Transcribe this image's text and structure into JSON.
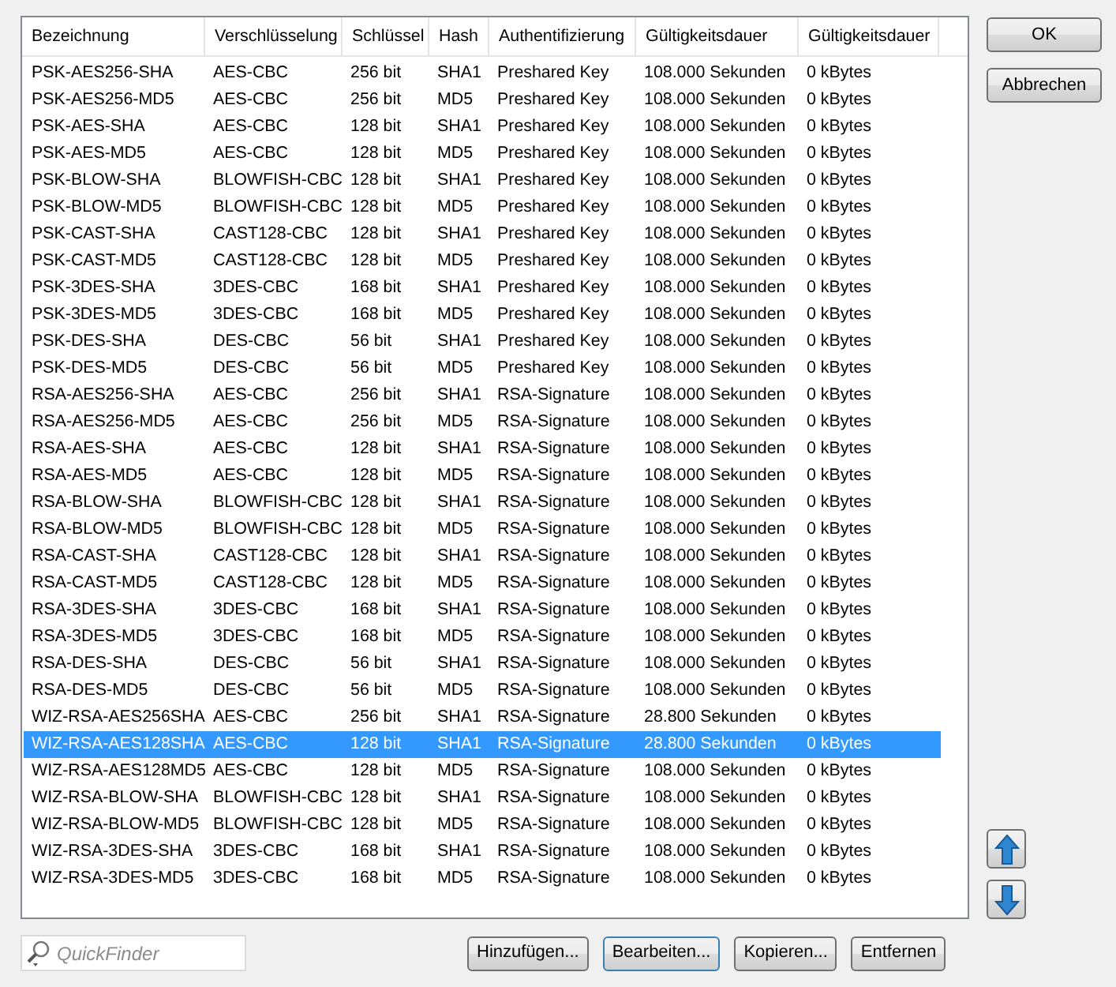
{
  "table": {
    "columns": [
      "Bezeichnung",
      "Verschlüsselung",
      "Schlüssel",
      "Hash",
      "Authentifizierung",
      "Gültigkeitsdauer",
      "Gültigkeitsdauer"
    ],
    "rows": [
      {
        "cells": [
          "PSK-AES256-SHA",
          "AES-CBC",
          "256 bit",
          "SHA1",
          "Preshared Key",
          "108.000 Sekunden",
          "0 kBytes"
        ],
        "selected": false
      },
      {
        "cells": [
          "PSK-AES256-MD5",
          "AES-CBC",
          "256 bit",
          "MD5",
          "Preshared Key",
          "108.000 Sekunden",
          "0 kBytes"
        ],
        "selected": false
      },
      {
        "cells": [
          "PSK-AES-SHA",
          "AES-CBC",
          "128 bit",
          "SHA1",
          "Preshared Key",
          "108.000 Sekunden",
          "0 kBytes"
        ],
        "selected": false
      },
      {
        "cells": [
          "PSK-AES-MD5",
          "AES-CBC",
          "128 bit",
          "MD5",
          "Preshared Key",
          "108.000 Sekunden",
          "0 kBytes"
        ],
        "selected": false
      },
      {
        "cells": [
          "PSK-BLOW-SHA",
          "BLOWFISH-CBC",
          "128 bit",
          "SHA1",
          "Preshared Key",
          "108.000 Sekunden",
          "0 kBytes"
        ],
        "selected": false
      },
      {
        "cells": [
          "PSK-BLOW-MD5",
          "BLOWFISH-CBC",
          "128 bit",
          "MD5",
          "Preshared Key",
          "108.000 Sekunden",
          "0 kBytes"
        ],
        "selected": false
      },
      {
        "cells": [
          "PSK-CAST-SHA",
          "CAST128-CBC",
          "128 bit",
          "SHA1",
          "Preshared Key",
          "108.000 Sekunden",
          "0 kBytes"
        ],
        "selected": false
      },
      {
        "cells": [
          "PSK-CAST-MD5",
          "CAST128-CBC",
          "128 bit",
          "MD5",
          "Preshared Key",
          "108.000 Sekunden",
          "0 kBytes"
        ],
        "selected": false
      },
      {
        "cells": [
          "PSK-3DES-SHA",
          "3DES-CBC",
          "168 bit",
          "SHA1",
          "Preshared Key",
          "108.000 Sekunden",
          "0 kBytes"
        ],
        "selected": false
      },
      {
        "cells": [
          "PSK-3DES-MD5",
          "3DES-CBC",
          "168 bit",
          "MD5",
          "Preshared Key",
          "108.000 Sekunden",
          "0 kBytes"
        ],
        "selected": false
      },
      {
        "cells": [
          "PSK-DES-SHA",
          "DES-CBC",
          "56 bit",
          "SHA1",
          "Preshared Key",
          "108.000 Sekunden",
          "0 kBytes"
        ],
        "selected": false
      },
      {
        "cells": [
          "PSK-DES-MD5",
          "DES-CBC",
          "56 bit",
          "MD5",
          "Preshared Key",
          "108.000 Sekunden",
          "0 kBytes"
        ],
        "selected": false
      },
      {
        "cells": [
          "RSA-AES256-SHA",
          "AES-CBC",
          "256 bit",
          "SHA1",
          "RSA-Signature",
          "108.000 Sekunden",
          "0 kBytes"
        ],
        "selected": false
      },
      {
        "cells": [
          "RSA-AES256-MD5",
          "AES-CBC",
          "256 bit",
          "MD5",
          "RSA-Signature",
          "108.000 Sekunden",
          "0 kBytes"
        ],
        "selected": false
      },
      {
        "cells": [
          "RSA-AES-SHA",
          "AES-CBC",
          "128 bit",
          "SHA1",
          "RSA-Signature",
          "108.000 Sekunden",
          "0 kBytes"
        ],
        "selected": false
      },
      {
        "cells": [
          "RSA-AES-MD5",
          "AES-CBC",
          "128 bit",
          "MD5",
          "RSA-Signature",
          "108.000 Sekunden",
          "0 kBytes"
        ],
        "selected": false
      },
      {
        "cells": [
          "RSA-BLOW-SHA",
          "BLOWFISH-CBC",
          "128 bit",
          "SHA1",
          "RSA-Signature",
          "108.000 Sekunden",
          "0 kBytes"
        ],
        "selected": false
      },
      {
        "cells": [
          "RSA-BLOW-MD5",
          "BLOWFISH-CBC",
          "128 bit",
          "MD5",
          "RSA-Signature",
          "108.000 Sekunden",
          "0 kBytes"
        ],
        "selected": false
      },
      {
        "cells": [
          "RSA-CAST-SHA",
          "CAST128-CBC",
          "128 bit",
          "SHA1",
          "RSA-Signature",
          "108.000 Sekunden",
          "0 kBytes"
        ],
        "selected": false
      },
      {
        "cells": [
          "RSA-CAST-MD5",
          "CAST128-CBC",
          "128 bit",
          "MD5",
          "RSA-Signature",
          "108.000 Sekunden",
          "0 kBytes"
        ],
        "selected": false
      },
      {
        "cells": [
          "RSA-3DES-SHA",
          "3DES-CBC",
          "168 bit",
          "SHA1",
          "RSA-Signature",
          "108.000 Sekunden",
          "0 kBytes"
        ],
        "selected": false
      },
      {
        "cells": [
          "RSA-3DES-MD5",
          "3DES-CBC",
          "168 bit",
          "MD5",
          "RSA-Signature",
          "108.000 Sekunden",
          "0 kBytes"
        ],
        "selected": false
      },
      {
        "cells": [
          "RSA-DES-SHA",
          "DES-CBC",
          "56 bit",
          "SHA1",
          "RSA-Signature",
          "108.000 Sekunden",
          "0 kBytes"
        ],
        "selected": false
      },
      {
        "cells": [
          "RSA-DES-MD5",
          "DES-CBC",
          "56 bit",
          "MD5",
          "RSA-Signature",
          "108.000 Sekunden",
          "0 kBytes"
        ],
        "selected": false
      },
      {
        "cells": [
          "WIZ-RSA-AES256SHA",
          "AES-CBC",
          "256 bit",
          "SHA1",
          "RSA-Signature",
          "28.800 Sekunden",
          "0 kBytes"
        ],
        "selected": false
      },
      {
        "cells": [
          "WIZ-RSA-AES128SHA",
          "AES-CBC",
          "128 bit",
          "SHA1",
          "RSA-Signature",
          "28.800 Sekunden",
          "0 kBytes"
        ],
        "selected": true
      },
      {
        "cells": [
          "WIZ-RSA-AES128MD5",
          "AES-CBC",
          "128 bit",
          "MD5",
          "RSA-Signature",
          "108.000 Sekunden",
          "0 kBytes"
        ],
        "selected": false
      },
      {
        "cells": [
          "WIZ-RSA-BLOW-SHA",
          "BLOWFISH-CBC",
          "128 bit",
          "SHA1",
          "RSA-Signature",
          "108.000 Sekunden",
          "0 kBytes"
        ],
        "selected": false
      },
      {
        "cells": [
          "WIZ-RSA-BLOW-MD5",
          "BLOWFISH-CBC",
          "128 bit",
          "MD5",
          "RSA-Signature",
          "108.000 Sekunden",
          "0 kBytes"
        ],
        "selected": false
      },
      {
        "cells": [
          "WIZ-RSA-3DES-SHA",
          "3DES-CBC",
          "168 bit",
          "SHA1",
          "RSA-Signature",
          "108.000 Sekunden",
          "0 kBytes"
        ],
        "selected": false
      },
      {
        "cells": [
          "WIZ-RSA-3DES-MD5",
          "3DES-CBC",
          "168 bit",
          "MD5",
          "RSA-Signature",
          "108.000 Sekunden",
          "0 kBytes"
        ],
        "selected": false
      }
    ]
  },
  "search": {
    "placeholder": "QuickFinder"
  },
  "bottom_buttons": [
    "Hinzufügen...",
    "Bearbeiten...",
    "Kopieren...",
    "Entfernen"
  ],
  "side_buttons": [
    "OK",
    "Abbrechen"
  ]
}
